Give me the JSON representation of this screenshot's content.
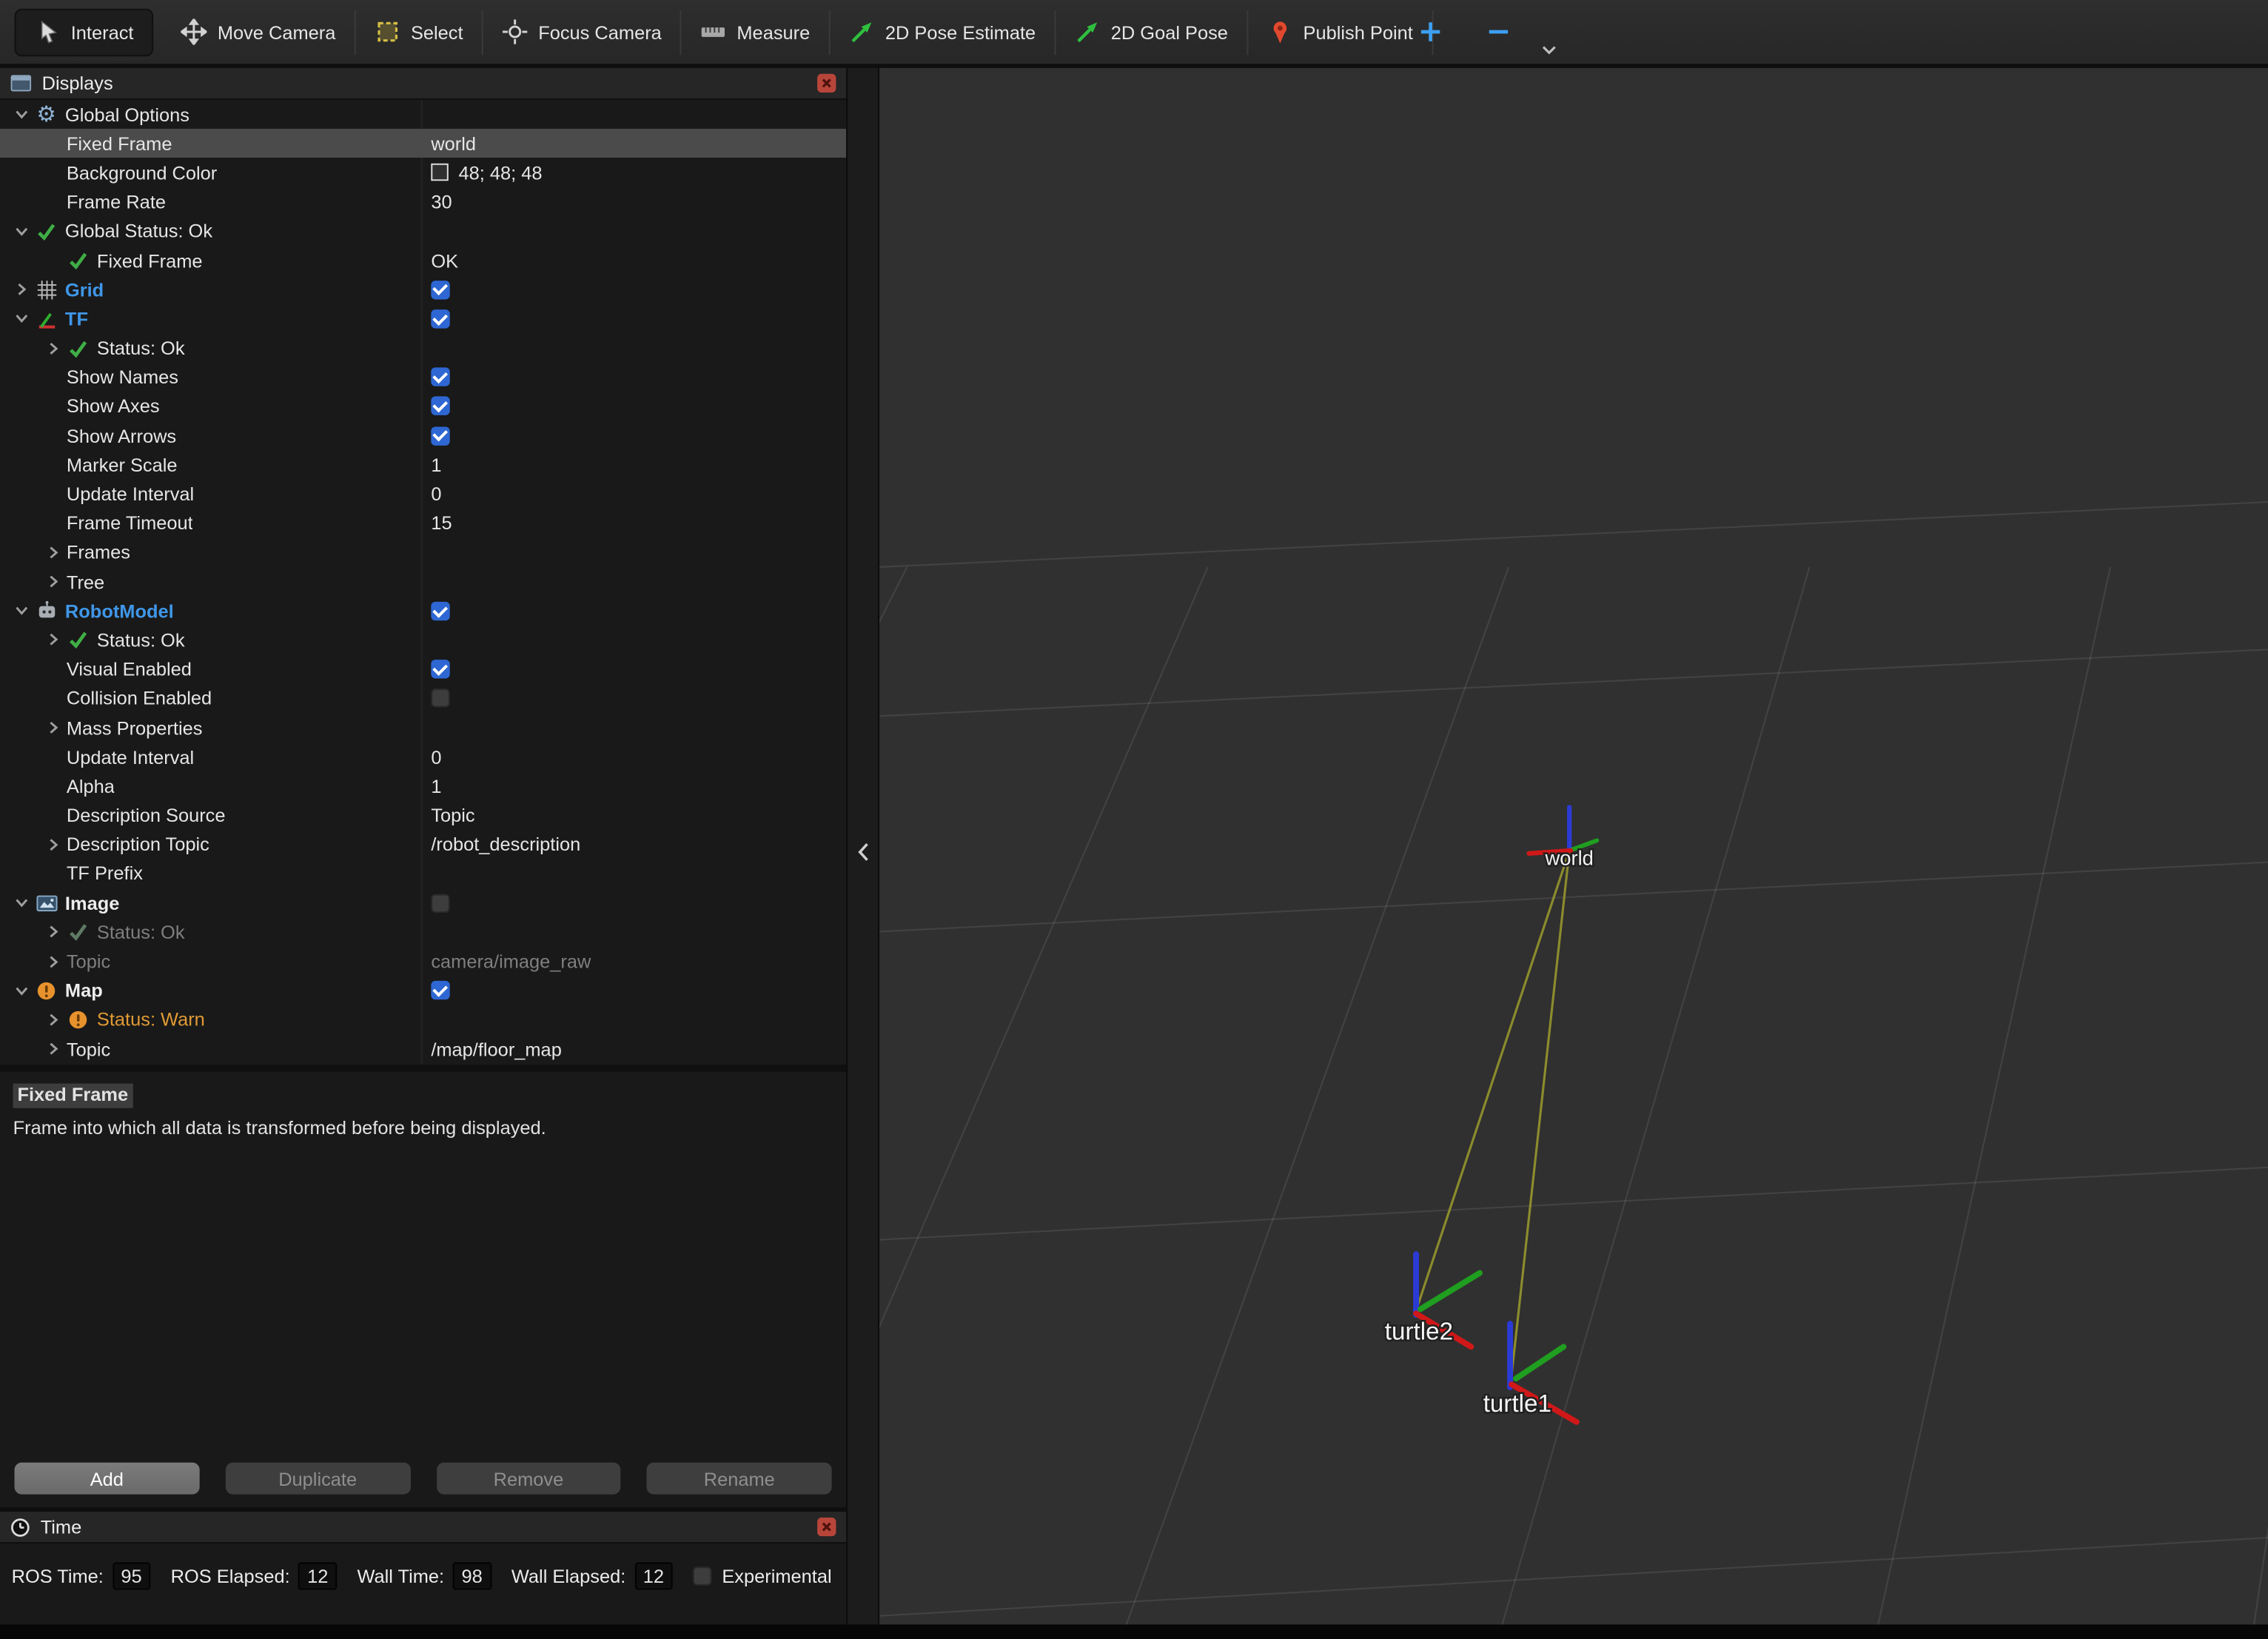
{
  "toolbar": {
    "tools": [
      {
        "label": "Interact",
        "icon": "interact-icon",
        "active": true
      },
      {
        "label": "Move Camera",
        "icon": "move-camera-icon",
        "active": false
      },
      {
        "label": "Select",
        "icon": "select-icon",
        "active": false
      },
      {
        "label": "Focus Camera",
        "icon": "focus-camera-icon",
        "active": false
      },
      {
        "label": "Measure",
        "icon": "measure-icon",
        "active": false
      },
      {
        "label": "2D Pose Estimate",
        "icon": "pose-estimate-icon",
        "active": false
      },
      {
        "label": "2D Goal Pose",
        "icon": "goal-pose-icon",
        "active": false
      },
      {
        "label": "Publish Point",
        "icon": "publish-point-icon",
        "active": false
      }
    ]
  },
  "displays": {
    "title": "Displays",
    "rows": [
      {
        "level": 0,
        "expander": "open",
        "icon": "gear-icon",
        "label": "Global Options"
      },
      {
        "level": 1,
        "label": "Fixed Frame",
        "value": {
          "type": "text",
          "text": "world"
        },
        "selected": true
      },
      {
        "level": 1,
        "label": "Background Color",
        "value": {
          "type": "color",
          "text": "48; 48; 48",
          "swatch": "#303030"
        }
      },
      {
        "level": 1,
        "label": "Frame Rate",
        "value": {
          "type": "text",
          "text": "30"
        }
      },
      {
        "level": 0,
        "expander": "open",
        "icon": "status-ok-icon",
        "label": "Global Status: Ok"
      },
      {
        "level": 1,
        "icon": "status-ok-icon",
        "label": "Fixed Frame",
        "value": {
          "type": "text",
          "text": "OK"
        }
      },
      {
        "level": 0,
        "expander": "closed",
        "icon": "grid-icon",
        "label": "Grid",
        "label_style": "display",
        "value": {
          "type": "checkbox",
          "checked": true
        }
      },
      {
        "level": 0,
        "expander": "open",
        "icon": "tf-icon",
        "label": "TF",
        "label_style": "display",
        "value": {
          "type": "checkbox",
          "checked": true
        }
      },
      {
        "level": 1,
        "expander": "closed",
        "icon": "status-ok-icon",
        "label": "Status: Ok"
      },
      {
        "level": 1,
        "label": "Show Names",
        "value": {
          "type": "checkbox",
          "checked": true
        }
      },
      {
        "level": 1,
        "label": "Show Axes",
        "value": {
          "type": "checkbox",
          "checked": true
        }
      },
      {
        "level": 1,
        "label": "Show Arrows",
        "value": {
          "type": "checkbox",
          "checked": true
        }
      },
      {
        "level": 1,
        "label": "Marker Scale",
        "value": {
          "type": "text",
          "text": "1"
        }
      },
      {
        "level": 1,
        "label": "Update Interval",
        "value": {
          "type": "text",
          "text": "0"
        }
      },
      {
        "level": 1,
        "label": "Frame Timeout",
        "value": {
          "type": "text",
          "text": "15"
        }
      },
      {
        "level": 1,
        "expander": "closed",
        "label": "Frames"
      },
      {
        "level": 1,
        "expander": "closed",
        "label": "Tree"
      },
      {
        "level": 0,
        "expander": "open",
        "icon": "robot-icon",
        "label": "RobotModel",
        "label_style": "display",
        "value": {
          "type": "checkbox",
          "checked": true
        }
      },
      {
        "level": 1,
        "expander": "closed",
        "icon": "status-ok-icon",
        "label": "Status: Ok"
      },
      {
        "level": 1,
        "label": "Visual Enabled",
        "value": {
          "type": "checkbox",
          "checked": true
        }
      },
      {
        "level": 1,
        "label": "Collision Enabled",
        "value": {
          "type": "checkbox",
          "checked": false
        }
      },
      {
        "level": 1,
        "expander": "closed",
        "label": "Mass Properties"
      },
      {
        "level": 1,
        "label": "Update Interval",
        "value": {
          "type": "text",
          "text": "0"
        }
      },
      {
        "level": 1,
        "label": "Alpha",
        "value": {
          "type": "text",
          "text": "1"
        }
      },
      {
        "level": 1,
        "label": "Description Source",
        "value": {
          "type": "text",
          "text": "Topic"
        }
      },
      {
        "level": 1,
        "expander": "closed",
        "label": "Description Topic",
        "value": {
          "type": "text",
          "text": "/robot_description"
        }
      },
      {
        "level": 1,
        "label": "TF Prefix"
      },
      {
        "level": 0,
        "expander": "open",
        "icon": "image-icon",
        "label": "Image",
        "label_style": "display-plain",
        "value": {
          "type": "checkbox",
          "checked": false
        }
      },
      {
        "level": 1,
        "expander": "closed",
        "icon": "status-ok-gray-icon",
        "label": "Status: Ok",
        "label_style": "muted"
      },
      {
        "level": 1,
        "expander": "closed",
        "label": "Topic",
        "label_style": "muted",
        "value": {
          "type": "text",
          "text": "camera/image_raw",
          "muted": true
        }
      },
      {
        "level": 0,
        "expander": "open",
        "icon": "warn-icon",
        "label": "Map",
        "label_style": "display-plain",
        "value": {
          "type": "checkbox",
          "checked": true
        }
      },
      {
        "level": 1,
        "expander": "closed",
        "icon": "warn-icon",
        "label": "Status: Warn",
        "label_style": "warn"
      },
      {
        "level": 1,
        "expander": "closed",
        "label": "Topic",
        "value": {
          "type": "text",
          "text": "/map/floor_map"
        }
      }
    ],
    "description_title": "Fixed Frame",
    "description_text": "Frame into which all data is transformed before being displayed.",
    "buttons": [
      {
        "label": "Add",
        "enabled": true
      },
      {
        "label": "Duplicate",
        "enabled": false
      },
      {
        "label": "Remove",
        "enabled": false
      },
      {
        "label": "Rename",
        "enabled": false
      }
    ]
  },
  "time": {
    "title": "Time",
    "fields": [
      {
        "label": "ROS Time:",
        "value": "95"
      },
      {
        "label": "ROS Elapsed:",
        "value": "12"
      },
      {
        "label": "Wall Time:",
        "value": "98"
      },
      {
        "label": "Wall Elapsed:",
        "value": "12"
      }
    ],
    "experimental_label": "Experimental",
    "experimental_checked": false
  },
  "viewport": {
    "background_color": "#303030",
    "frames": [
      {
        "label": "world"
      },
      {
        "label": "turtle2"
      },
      {
        "label": "turtle1"
      }
    ]
  },
  "colors": {
    "accent_blue": "#3f97e8",
    "status_ok_green": "#3fae46",
    "status_warn_orange": "#e8922d",
    "selection_gray": "#4b4b4b",
    "axis_red": "#d01818",
    "axis_green": "#1f9e1f",
    "axis_blue": "#2b3bd6",
    "tf_link_yellow": "#96962e"
  }
}
